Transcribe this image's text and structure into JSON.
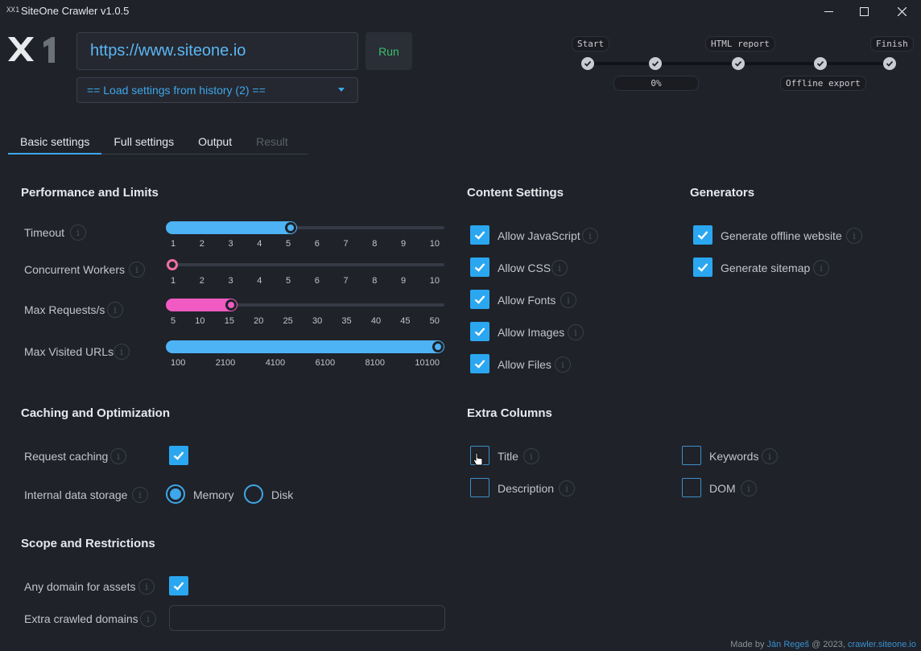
{
  "window": {
    "title": "SiteOne Crawler v1.0.5",
    "icon_text": "XX1",
    "controls": [
      "minimize-icon",
      "maximize-icon",
      "close-icon"
    ]
  },
  "header": {
    "url_value": "https://www.siteone.io",
    "run_label": "Run",
    "history_select": "== Load settings from history (2) =="
  },
  "progress": {
    "steps": [
      {
        "label": "Start",
        "done": true
      },
      {
        "label": "0%",
        "done": true
      },
      {
        "label": "HTML report",
        "done": true
      },
      {
        "label": "Offline export",
        "done": true
      },
      {
        "label": "Finish",
        "done": true
      }
    ]
  },
  "tabs": [
    {
      "label": "Basic settings",
      "active": true
    },
    {
      "label": "Full settings"
    },
    {
      "label": "Output"
    },
    {
      "label": "Result",
      "disabled": true
    }
  ],
  "performance": {
    "title": "Performance and Limits",
    "sliders": [
      {
        "label": "Timeout",
        "ticks": [
          "1",
          "2",
          "3",
          "4",
          "5",
          "6",
          "7",
          "8",
          "9",
          "10"
        ],
        "value": 5,
        "min": 1,
        "max": 10,
        "color": "#4db3f5"
      },
      {
        "label": "Concurrent Workers",
        "ticks": [
          "1",
          "2",
          "3",
          "4",
          "5",
          "6",
          "7",
          "8",
          "9",
          "10"
        ],
        "value": 1,
        "min": 1,
        "max": 10,
        "color": "#f06ea6"
      },
      {
        "label": "Max Requests/s",
        "ticks": [
          "5",
          "10",
          "15",
          "20",
          "25",
          "30",
          "35",
          "40",
          "45",
          "50"
        ],
        "value": 15,
        "min": 5,
        "max": 50,
        "color": "#f05ac2"
      },
      {
        "label": "Max Visited URLs",
        "ticks": [
          "100",
          "2100",
          "4100",
          "6100",
          "8100",
          "10100"
        ],
        "value": 10100,
        "min": 100,
        "max": 10100,
        "color": "#4db3f5"
      }
    ]
  },
  "content": {
    "title": "Content Settings",
    "options": [
      {
        "label": "Allow JavaScript",
        "checked": true
      },
      {
        "label": "Allow CSS",
        "checked": true
      },
      {
        "label": "Allow Fonts",
        "checked": true
      },
      {
        "label": "Allow Images",
        "checked": true
      },
      {
        "label": "Allow Files",
        "checked": true
      }
    ]
  },
  "generators": {
    "title": "Generators",
    "options": [
      {
        "label": "Generate offline website",
        "checked": true
      },
      {
        "label": "Generate sitemap",
        "checked": true
      }
    ]
  },
  "caching": {
    "title": "Caching and Optimization",
    "request_caching_label": "Request caching",
    "request_caching": true,
    "storage_label": "Internal data storage",
    "storage_options": [
      "Memory",
      "Disk"
    ],
    "storage_selected": "Memory"
  },
  "extra_columns": {
    "title": "Extra Columns",
    "options": [
      {
        "label": "Title",
        "checked": false
      },
      {
        "label": "Description",
        "checked": false
      },
      {
        "label": "Keywords",
        "checked": false
      },
      {
        "label": "DOM",
        "checked": false
      }
    ]
  },
  "scope": {
    "title": "Scope and Restrictions",
    "any_domain_label": "Any domain for assets",
    "any_domain": true,
    "extra_domains_label": "Extra crawled domains",
    "extra_domains_value": ""
  },
  "footer": {
    "prefix": "Made by ",
    "author": "Ján Regeš",
    "middle": " @ 2023, ",
    "site": "crawler.siteone.io"
  }
}
